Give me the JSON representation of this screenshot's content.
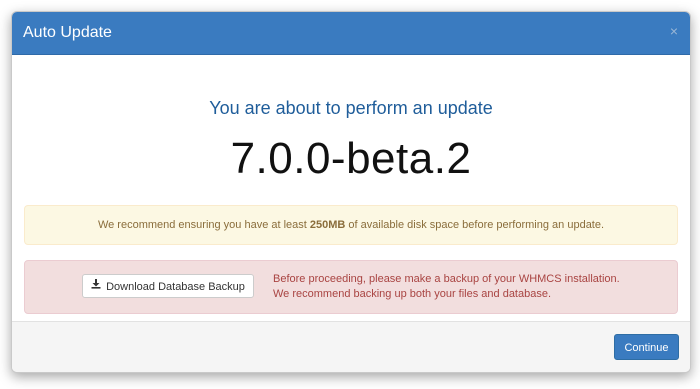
{
  "modal": {
    "title": "Auto Update",
    "close_symbol": "×"
  },
  "body": {
    "intro": "You are about to perform an update",
    "version": "7.0.0-beta.2"
  },
  "warning": {
    "prefix": "We recommend ensuring you have at least ",
    "emphasis": "250MB",
    "suffix": " of available disk space before performing an update."
  },
  "danger": {
    "button_label": "Download Database Backup",
    "button_icon": "download-icon",
    "line1": "Before proceeding, please make a backup of your WHMCS installation.",
    "line2": "We recommend backing up both your files and database."
  },
  "footer": {
    "continue_label": "Continue"
  },
  "colors": {
    "header": "#3a7bc0",
    "warning_bg": "#fcf8e3",
    "warning_text": "#8a6d3b",
    "danger_bg": "#f2dede",
    "danger_text": "#a94442",
    "primary_button": "#3a7bc0"
  }
}
